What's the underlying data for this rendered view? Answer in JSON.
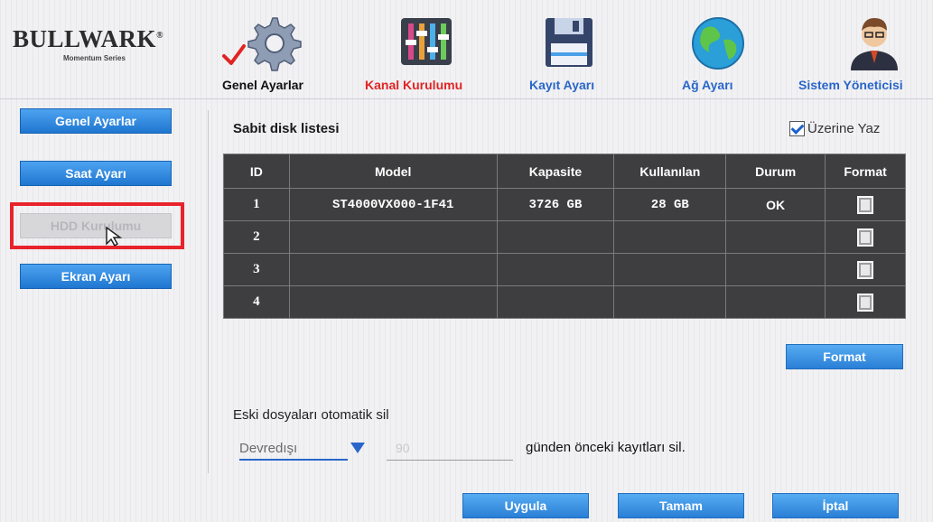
{
  "brand": {
    "name": "BULLWARK",
    "trademark": "®",
    "subtitle": "Momentum Series"
  },
  "nav": [
    {
      "label": "Genel Ayarlar",
      "icon": "gear-icon",
      "state": "checked"
    },
    {
      "label": "Kanal Kurulumu",
      "icon": "equalizer-icon",
      "state": "active"
    },
    {
      "label": "Kayıt Ayarı",
      "icon": "floppy-disk-icon",
      "state": "normal"
    },
    {
      "label": "Ağ Ayarı",
      "icon": "globe-icon",
      "state": "normal"
    },
    {
      "label": "Sistem Yöneticisi",
      "icon": "admin-user-icon",
      "state": "normal"
    }
  ],
  "sidebar": {
    "items": [
      {
        "label": "Genel Ayarlar",
        "enabled": true
      },
      {
        "label": "Saat Ayarı",
        "enabled": true
      },
      {
        "label": "HDD Kurulumu",
        "enabled": false,
        "highlighted": true
      },
      {
        "label": "Ekran Ayarı",
        "enabled": true
      }
    ]
  },
  "main": {
    "section_title": "Sabit disk listesi",
    "overwrite": {
      "label": "Üzerine Yaz",
      "checked": true
    },
    "table": {
      "columns": [
        "ID",
        "Model",
        "Kapasite",
        "Kullanılan",
        "Durum",
        "Format"
      ],
      "rows": [
        {
          "id": "1",
          "model": "ST4000VX000-1F41",
          "capacity": "3726 GB",
          "used": "28 GB",
          "status": "OK"
        },
        {
          "id": "2",
          "model": "",
          "capacity": "",
          "used": "",
          "status": ""
        },
        {
          "id": "3",
          "model": "",
          "capacity": "",
          "used": "",
          "status": ""
        },
        {
          "id": "4",
          "model": "",
          "capacity": "",
          "used": "",
          "status": ""
        }
      ]
    },
    "format_button": "Format",
    "auto_delete": {
      "label": "Eski dosyaları otomatik sil",
      "select_value": "Devredışı",
      "days_value": "90",
      "suffix": "günden önceki kayıtları sil."
    }
  },
  "footer": {
    "apply": "Uygula",
    "ok": "Tamam",
    "cancel": "İptal"
  },
  "colors": {
    "accent_blue": "#2a7fd6",
    "active_red": "#e02424",
    "highlight_red": "#e8232b",
    "table_bg": "#3e3e40"
  }
}
